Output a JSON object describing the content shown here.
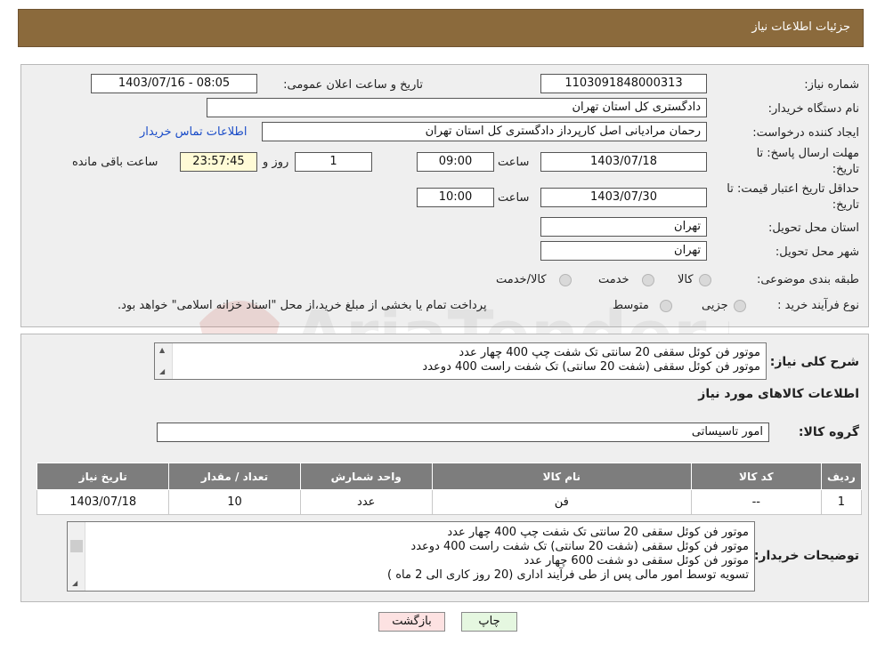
{
  "header": {
    "title": "جزئیات اطلاعات نیاز"
  },
  "watermark_text": "AriaTender.neT",
  "form": {
    "need_number_label": "شماره نیاز:",
    "need_number": "1103091848000313",
    "announce_label": "تاریخ و ساعت اعلان عمومی:",
    "announce_value": "1403/07/16 - 08:05",
    "buyer_org_label": "نام دستگاه خریدار:",
    "buyer_org": "دادگستری کل استان تهران",
    "requester_label": "ایجاد کننده درخواست:",
    "requester": "رحمان مرادیانی اصل کارپرداز دادگستری کل استان تهران",
    "contact_link": "اطلاعات تماس خریدار",
    "deadline_label_1": "مهلت ارسال پاسخ: تا",
    "deadline_label_2": "تاریخ:",
    "deadline_date": "1403/07/18",
    "time_label": "ساعت",
    "deadline_time": "09:00",
    "days_value": "1",
    "days_label": "روز و",
    "remaining_time": "23:57:45",
    "remaining_label": "ساعت باقی مانده",
    "validity_label_1": "حداقل تاریخ اعتبار قیمت: تا",
    "validity_label_2": "تاریخ:",
    "validity_date": "1403/07/30",
    "validity_time_label": "ساعت",
    "validity_time": "10:00",
    "province_label": "استان محل تحویل:",
    "province": "تهران",
    "city_label": "شهر محل تحویل:",
    "city": "تهران",
    "category_label": "طبقه بندی موضوعی:",
    "category_options": [
      "کالا",
      "خدمت",
      "کالا/خدمت"
    ],
    "process_label": "نوع فرآیند خرید :",
    "process_options": [
      "جزیی",
      "متوسط"
    ],
    "process_note": "پرداخت تمام یا بخشی از مبلغ خرید،از محل \"اسناد خزانه اسلامی\" خواهد بود."
  },
  "details": {
    "summary_label": "شرح کلی نیاز:",
    "summary_lines": [
      "موتور فن کوئل سقفی 20 سانتی تک شفت چپ 400 چهار عدد",
      "موتور فن کوئل سقفی (شفت 20 سانتی) تک شفت راست 400 دوعدد"
    ],
    "goods_info_title": "اطلاعات کالاهای مورد نیاز",
    "goods_group_label": "گروه کالا:",
    "goods_group": "امور تاسیساتی",
    "table": {
      "headers": [
        "ردیف",
        "کد کالا",
        "نام کالا",
        "واحد شمارش",
        "تعداد / مقدار",
        "تاریخ نیاز"
      ],
      "rows": [
        [
          "1",
          "--",
          "فن",
          "عدد",
          "10",
          "1403/07/18"
        ]
      ]
    },
    "buyer_notes_label": "توضیحات خریدار:",
    "buyer_notes_lines": [
      "موتور فن کوئل سقفی 20 سانتی تک شفت چپ 400 چهار عدد",
      "موتور فن کوئل سقفی (شفت 20 سانتی) تک شفت راست 400 دوعدد",
      "موتور فن کوئل سقفی دو شفت  600  چهار عدد",
      "تسویه توسط امور مالی پس از طی فرآیند اداری (20 روز کاری الی 2 ماه )"
    ]
  },
  "buttons": {
    "print": "چاپ",
    "back": "بازگشت"
  },
  "colors": {
    "header": "#8b6a3c",
    "panel": "#efefef",
    "table_header": "#7d7d7d",
    "back_button": "#fde2e2",
    "print_button": "#e5f7e0",
    "link": "#1a4cc8"
  }
}
